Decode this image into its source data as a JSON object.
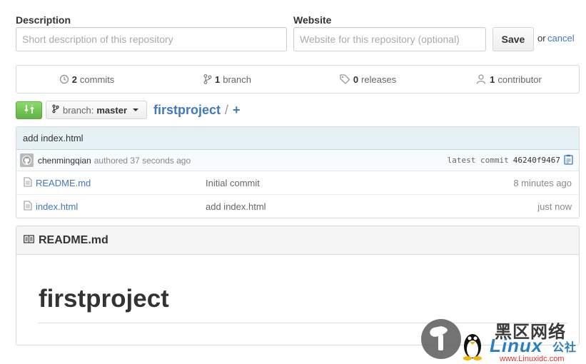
{
  "form": {
    "description_label": "Description",
    "description_placeholder": "Short description of this repository",
    "website_label": "Website",
    "website_placeholder": "Website for this repository (optional)",
    "save_label": "Save",
    "or_text": "or",
    "cancel_label": "cancel"
  },
  "summary": {
    "commits": {
      "count": "2",
      "label": "commits",
      "icon": "history-icon"
    },
    "branches": {
      "count": "1",
      "label": "branch",
      "icon": "git-branch-icon"
    },
    "releases": {
      "count": "0",
      "label": "releases",
      "icon": "tag-icon"
    },
    "contributors": {
      "count": "1",
      "label": "contributor",
      "icon": "organization-icon"
    }
  },
  "branch_bar": {
    "branch_prefix": "branch:",
    "branch_name": "master",
    "repo_name": "firstproject",
    "separator": "/",
    "add_label": "+"
  },
  "latest_commit": {
    "message": "add index.html",
    "author": "chenmingqian",
    "authored_text": "authored 37 seconds ago",
    "latest_label": "latest commit",
    "sha": "46240f9467"
  },
  "files": [
    {
      "name": "README.md",
      "message": "Initial commit",
      "age": "8 minutes ago"
    },
    {
      "name": "index.html",
      "message": "add index.html",
      "age": "just now"
    }
  ],
  "readme": {
    "file_name": "README.md",
    "heading": "firstproject"
  },
  "watermark": {
    "cn_title": "黑区网络",
    "brand": "Linux",
    "brand_suffix": "公社",
    "url": "www.Linuxidc.com"
  },
  "colors": {
    "link": "#4078c0",
    "compare_green": "#6cc644",
    "commit_bg": "#e6f1f6"
  }
}
